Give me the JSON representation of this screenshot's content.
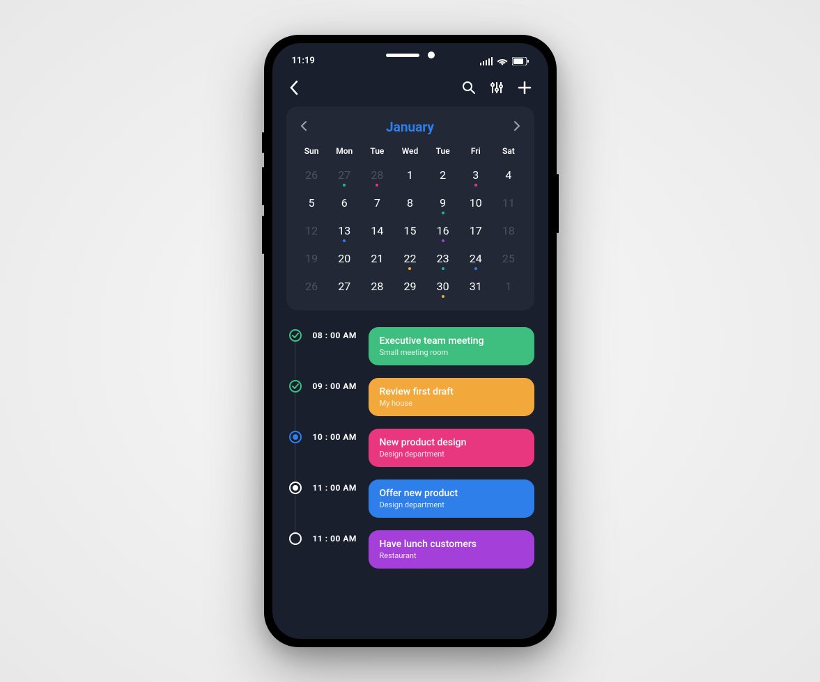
{
  "status": {
    "time": "11:19"
  },
  "colors": {
    "green": "#3fbf7f",
    "orange": "#f3a83b",
    "pink": "#e8367f",
    "blue": "#2e7fea",
    "purple": "#a43fd9",
    "teal": "#1fb5a7"
  },
  "month": {
    "name": "January"
  },
  "days": [
    "Sun",
    "Mon",
    "Tue",
    "Wed",
    "Tue",
    "Fri",
    "Sat"
  ],
  "calendar": [
    [
      {
        "n": "26",
        "dim": true
      },
      {
        "n": "27",
        "dim": true,
        "dot": "#1fb5a7"
      },
      {
        "n": "28",
        "dim": true,
        "dot": "#e8367f"
      },
      {
        "n": "1"
      },
      {
        "n": "2"
      },
      {
        "n": "3",
        "dot": "#e8367f"
      },
      {
        "n": "4"
      }
    ],
    [
      {
        "n": "5"
      },
      {
        "n": "6"
      },
      {
        "n": "7"
      },
      {
        "n": "8"
      },
      {
        "n": "9",
        "dot": "#1fb5a7"
      },
      {
        "n": "10"
      },
      {
        "n": "11",
        "dim": true
      }
    ],
    [
      {
        "n": "12",
        "dim": true
      },
      {
        "n": "13",
        "dot": "#2e7fea"
      },
      {
        "n": "14"
      },
      {
        "n": "15"
      },
      {
        "n": "16",
        "dot": "#a43fd9"
      },
      {
        "n": "17"
      },
      {
        "n": "18",
        "dim": true
      }
    ],
    [
      {
        "n": "19",
        "dim": true
      },
      {
        "n": "20"
      },
      {
        "n": "21"
      },
      {
        "n": "22",
        "dot": "#f3a83b"
      },
      {
        "n": "23",
        "dot": "#1fb5a7"
      },
      {
        "n": "24",
        "dot": "#2e7fea"
      },
      {
        "n": "25",
        "dim": true
      }
    ],
    [
      {
        "n": "26",
        "dim": true
      },
      {
        "n": "27"
      },
      {
        "n": "28"
      },
      {
        "n": "29"
      },
      {
        "n": "30",
        "dot": "#f3a83b"
      },
      {
        "n": "31"
      },
      {
        "n": "1",
        "dim": true
      }
    ]
  ],
  "events": [
    {
      "time": "08 : 00 AM",
      "title": "Executive team meeting",
      "loc": "Small meeting room",
      "color": "#3fbf7f",
      "marker": "done",
      "w": "100%"
    },
    {
      "time": "09 : 00 AM",
      "title": "Review first draft",
      "loc": "My house",
      "color": "#f3a83b",
      "marker": "done",
      "w": "88%"
    },
    {
      "time": "10 : 00 AM",
      "title": "New product design",
      "loc": "Design department",
      "color": "#e8367f",
      "marker": "current",
      "w": "100%"
    },
    {
      "time": "11 : 00 AM",
      "title": "Offer new product",
      "loc": "Design department",
      "color": "#2e7fea",
      "marker": "pending-dot",
      "w": "76%"
    },
    {
      "time": "11 : 00 AM",
      "title": "Have lunch customers",
      "loc": "Restaurant",
      "color": "#a43fd9",
      "marker": "pending",
      "w": "100%"
    }
  ]
}
